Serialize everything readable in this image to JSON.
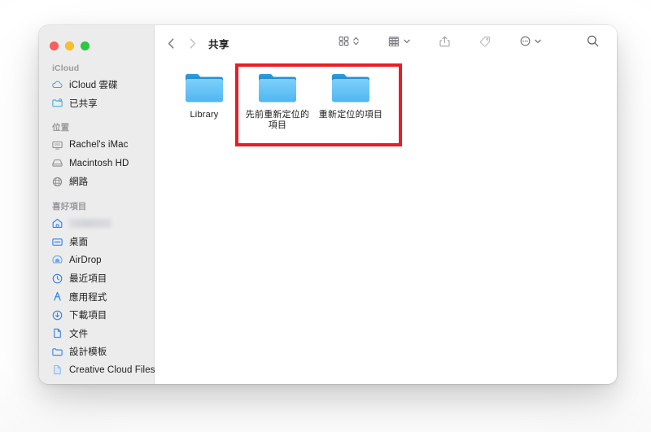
{
  "window": {
    "traffic_lights": [
      {
        "name": "close",
        "color": "#fb5f57",
        "label": "關閉"
      },
      {
        "name": "minimize",
        "color": "#fcbd2b",
        "label": "縮到最小"
      },
      {
        "name": "maximize",
        "color": "#2bc840",
        "label": "全螢幕"
      }
    ]
  },
  "toolbar": {
    "back_icon": "chevron-left-icon",
    "forward_icon": "chevron-right-icon",
    "title": "共享",
    "buttons": [
      {
        "name": "view-mode-button",
        "icon": "grid-view-icon",
        "has_chevron": true
      },
      {
        "name": "group-by-button",
        "icon": "list-rows-icon",
        "has_chevron": true
      },
      {
        "name": "share-button",
        "icon": "share-icon",
        "has_chevron": false
      },
      {
        "name": "tags-button",
        "icon": "tag-icon",
        "has_chevron": false
      },
      {
        "name": "more-actions-button",
        "icon": "ellipsis-circle-icon",
        "has_chevron": true
      },
      {
        "name": "search-button",
        "icon": "search-icon",
        "has_chevron": false
      }
    ]
  },
  "sidebar": {
    "sections": [
      {
        "title": "iCloud",
        "items": [
          {
            "label": "iCloud 雲碟",
            "icon": "cloud-icon",
            "tint": "blue"
          },
          {
            "label": "已共享",
            "icon": "shared-folder-icon",
            "tint": "blue"
          }
        ]
      },
      {
        "title": "位置",
        "items": [
          {
            "label": "Rachel's iMac",
            "icon": "display-icon",
            "tint": "gray"
          },
          {
            "label": "Macintosh HD",
            "icon": "harddisk-icon",
            "tint": "gray"
          },
          {
            "label": "網路",
            "icon": "globe-icon",
            "tint": "gray"
          }
        ]
      },
      {
        "title": "喜好項目",
        "items": [
          {
            "label": "",
            "icon": "home-icon",
            "tint": "blue",
            "redacted": true
          },
          {
            "label": "桌面",
            "icon": "desktop-icon",
            "tint": "blue"
          },
          {
            "label": "AirDrop",
            "icon": "airdrop-icon",
            "tint": "blue"
          },
          {
            "label": "最近項目",
            "icon": "clock-icon",
            "tint": "blue"
          },
          {
            "label": "應用程式",
            "icon": "applications-icon",
            "tint": "blue"
          },
          {
            "label": "下載項目",
            "icon": "download-icon",
            "tint": "blue"
          },
          {
            "label": "文件",
            "icon": "document-icon",
            "tint": "blue"
          },
          {
            "label": "設計模板",
            "icon": "folder-icon",
            "tint": "blue"
          },
          {
            "label": "Creative Cloud Files",
            "icon": "document-icon",
            "tint": "lightblue"
          }
        ]
      }
    ]
  },
  "content": {
    "items": [
      {
        "name": "Library",
        "icon": "folder-icon",
        "highlighted": false
      },
      {
        "name": "先前重新定位的項目",
        "icon": "folder-icon",
        "highlighted": true
      },
      {
        "name": "重新定位的項目",
        "icon": "folder-icon",
        "highlighted": true
      }
    ],
    "annotation": {
      "type": "rectangle",
      "color": "#ec1c24",
      "covers": [
        "先前重新定位的項目",
        "重新定位的項目"
      ]
    }
  },
  "colors": {
    "folder_front": "#59bcf5",
    "folder_back": "#2796d9",
    "sidebar_bg": "#ececec",
    "accent_blue": "#2e7ff0",
    "annotation_red": "#ec1c24"
  }
}
